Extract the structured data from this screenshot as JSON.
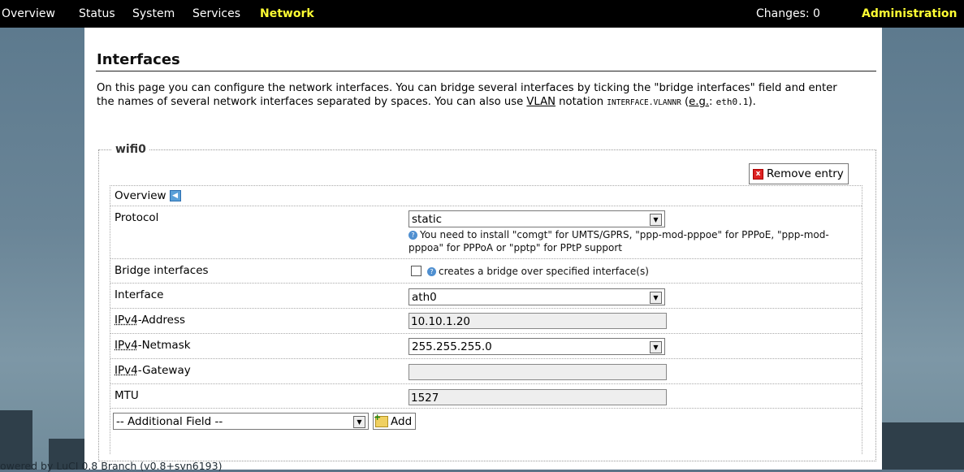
{
  "menu": {
    "items": [
      {
        "label": "Overview"
      },
      {
        "label": "Status"
      },
      {
        "label": "System"
      },
      {
        "label": "Services"
      },
      {
        "label": "Network",
        "active": true
      }
    ],
    "changes": "Changes: 0",
    "administration": "Administration"
  },
  "page": {
    "title": "Interfaces",
    "desc_1": "On this page you can configure the network interfaces. You can bridge several interfaces by ticking the \"bridge interfaces\" field and enter the names of several network interfaces separated by spaces. You can also use ",
    "desc_vlan": "VLAN",
    "desc_2": " notation ",
    "desc_code": "INTERFACE.VLANNR",
    "desc_3": " (",
    "desc_eg": "e.g.",
    "desc_4": ": ",
    "desc_code2": "eth0.1",
    "desc_5": ")."
  },
  "section": {
    "legend": "wifi0",
    "remove_label": "Remove entry",
    "overview_label": "Overview",
    "protocol": {
      "label": "Protocol",
      "value": "static",
      "hint": "You need to install \"comgt\" for UMTS/GPRS, \"ppp-mod-pppoe\" for PPPoE, \"ppp-mod-pppoa\" for PPPoA or \"pptp\" for PPtP support"
    },
    "bridge": {
      "label": "Bridge interfaces",
      "checked": false,
      "hint": "creates a bridge over specified interface(s)"
    },
    "interface": {
      "label": "Interface",
      "value": "ath0"
    },
    "ipv4_address": {
      "label_abbr": "IPv4",
      "label_rest": "-Address",
      "value": "10.10.1.20"
    },
    "ipv4_netmask": {
      "label_abbr": "IPv4",
      "label_rest": "-Netmask",
      "value": "255.255.255.0"
    },
    "ipv4_gateway": {
      "label_abbr": "IPv4",
      "label_rest": "-Gateway",
      "value": ""
    },
    "mtu": {
      "label": "MTU",
      "value": "1527"
    },
    "additional_field": "-- Additional Field --",
    "add_label": "Add"
  },
  "footer": "owered by LuCI 0.8 Branch (v0.8+svn6193)",
  "colors": {
    "topbar": "#000000",
    "accent": "#ffff33",
    "background": "#5b7488"
  }
}
